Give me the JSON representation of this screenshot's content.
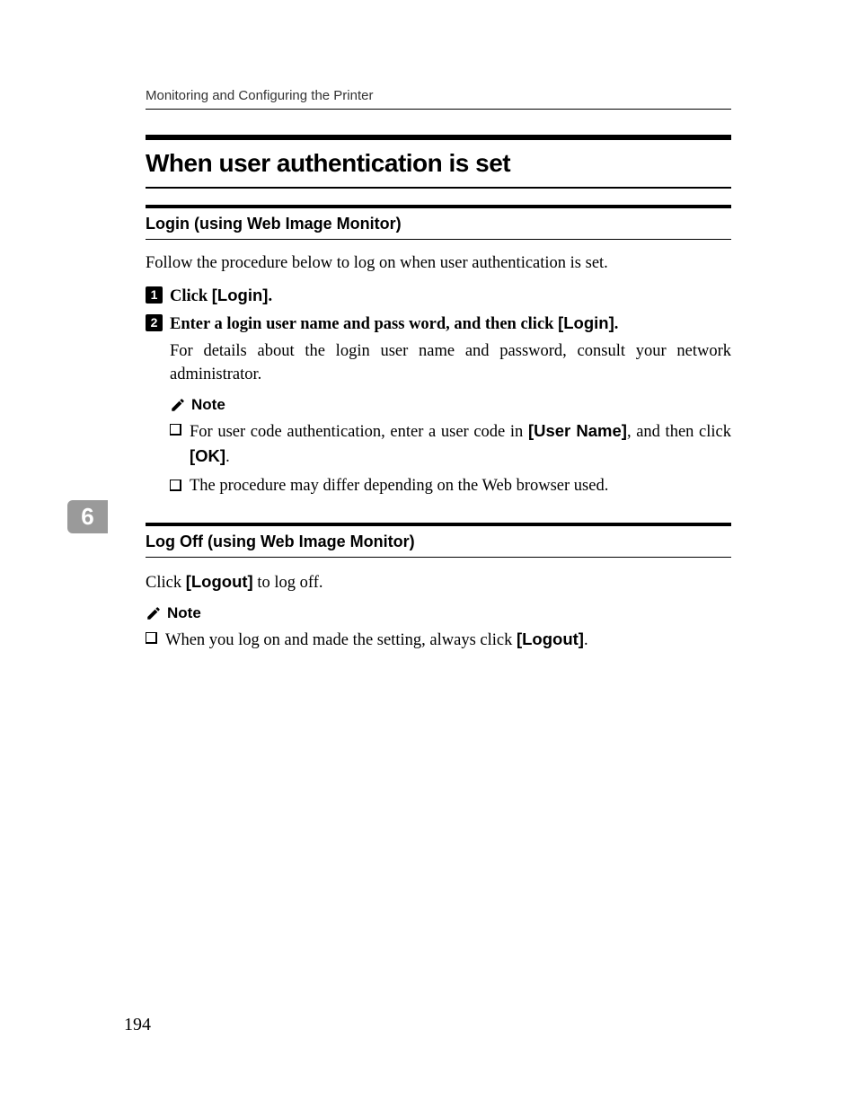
{
  "running_header": "Monitoring and Configuring the Printer",
  "section_title": "When user authentication is set",
  "login": {
    "heading": "Login (using Web Image Monitor)",
    "intro": "Follow the procedure below to log on when user authentication is set.",
    "steps": [
      {
        "num": "1",
        "text_pre": "Click ",
        "ui": "[Login]",
        "text_post": "."
      },
      {
        "num": "2",
        "text_pre": "Enter a login user name and pass word, and then click ",
        "ui": "[Login]",
        "text_post": ".",
        "detail": "For details about the login user name and password, consult your network administrator."
      }
    ],
    "note_label": "Note",
    "notes": [
      {
        "pre": "For user code authentication, enter a user code in ",
        "ui1": "[User Name]",
        "mid": ", and then click ",
        "ui2": "[OK]",
        "post": "."
      },
      {
        "pre": "The procedure may differ depending on the Web browser used.",
        "ui1": "",
        "mid": "",
        "ui2": "",
        "post": ""
      }
    ]
  },
  "logoff": {
    "heading": "Log Off (using Web Image Monitor)",
    "body_pre": "Click ",
    "body_ui": "[Logout]",
    "body_post": " to log off.",
    "note_label": "Note",
    "notes": [
      {
        "pre": "When you log on and made the setting, always click ",
        "ui1": "[Logout]",
        "mid": "",
        "ui2": "",
        "post": "."
      }
    ]
  },
  "tab_number": "6",
  "page_number": "194"
}
